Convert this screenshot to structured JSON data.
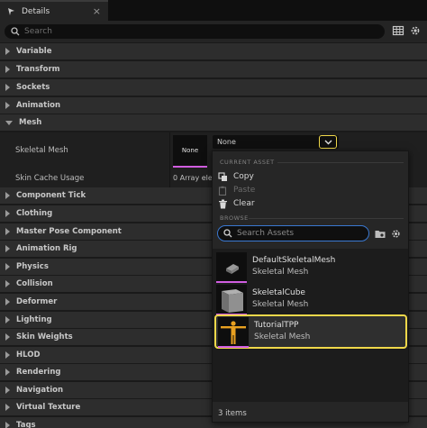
{
  "tab": {
    "title": "Details",
    "close": "×"
  },
  "search": {
    "placeholder": "Search"
  },
  "categories": [
    "Variable",
    "Transform",
    "Sockets",
    "Animation",
    "Mesh",
    "Component Tick",
    "Clothing",
    "Master Pose Component",
    "Animation Rig",
    "Physics",
    "Collision",
    "Deformer",
    "Lighting",
    "Skin Weights",
    "HLOD",
    "Rendering",
    "Navigation",
    "Virtual Texture",
    "Tags"
  ],
  "mesh": {
    "skeletal_mesh_label": "Skeletal Mesh",
    "thumb_text": "None",
    "combo_value": "None",
    "skin_cache_label": "Skin Cache Usage",
    "skin_cache_value": "0 Array elem"
  },
  "popup": {
    "current_asset_header": "CURRENT ASSET",
    "copy": "Copy",
    "paste": "Paste",
    "clear": "Clear",
    "browse_header": "BROWSE",
    "search_placeholder": "Search Assets",
    "assets": [
      {
        "name": "DefaultSkeletalMesh",
        "type": "Skeletal Mesh"
      },
      {
        "name": "SkeletalCube",
        "type": "Skeletal Mesh"
      },
      {
        "name": "TutorialTPP",
        "type": "Skeletal Mesh"
      }
    ],
    "item_count": "3 items"
  },
  "colors": {
    "highlight": "#f0d84a",
    "mesh_accent": "#d05de0",
    "search_focus": "#3a78d0"
  }
}
